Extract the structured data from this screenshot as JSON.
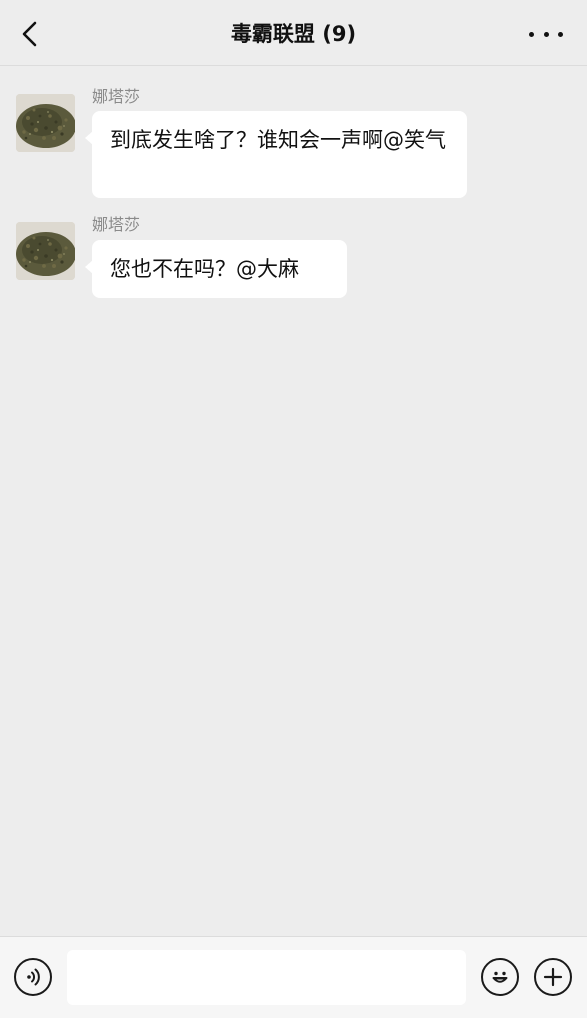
{
  "header": {
    "title": "毒霸联盟 (9)",
    "back_icon": "chevron-left-icon",
    "more_icon": "more-horizontal-icon"
  },
  "messages": [
    {
      "sender": "娜塔莎",
      "text": "到底发生啥了？谁知会一声啊@笑气"
    },
    {
      "sender": "娜塔莎",
      "text": "您也不在吗？@大麻"
    }
  ],
  "input_bar": {
    "voice_icon": "voice-icon",
    "text_value": "",
    "emoji_icon": "emoji-icon",
    "add_icon": "plus-icon"
  }
}
